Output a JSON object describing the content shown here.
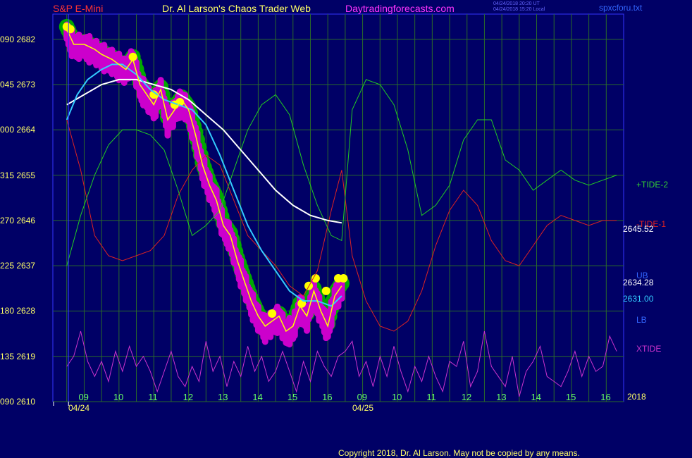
{
  "header": {
    "symbol": "S&P E-Mini",
    "author": "Dr. Al Larson's Chaos Trader Web",
    "site": "Daytradingforecasts.com",
    "stamp_ut": "04/24/2018 20:20 UT",
    "stamp_local": "04/24/2018 15:20 Local",
    "file": "spxcforu.txt"
  },
  "copyright": "Copyright 2018, Dr. Al Larson. May not be copied by any means.",
  "colors": {
    "background": "#000066",
    "plot_border": "#3333ff",
    "grid": "#2a6a2a",
    "price": "#ffff00",
    "bands": "#00aa00",
    "bars": "#cc00cc",
    "dots": "#ffff00",
    "fast_ma": "#33ccff",
    "slow_ma": "#ffffff",
    "tide2": "#22cc22",
    "tide1": "#dd2222",
    "xtide": "#cc33cc"
  },
  "chart_data": {
    "type": "line",
    "title": "S&P E-Mini",
    "ylim": [
      2610,
      2687
    ],
    "y_ticks": [
      {
        "prefix": "090",
        "value": "2682"
      },
      {
        "prefix": "045",
        "value": "2673"
      },
      {
        "prefix": "000",
        "value": "2664"
      },
      {
        "prefix": "315",
        "value": "2655"
      },
      {
        "prefix": "270",
        "value": "2646"
      },
      {
        "prefix": "225",
        "value": "2637"
      },
      {
        "prefix": "180",
        "value": "2628"
      },
      {
        "prefix": "135",
        "value": "2619"
      },
      {
        "prefix": "090",
        "value": "2610"
      }
    ],
    "x_ticks": [
      "09",
      "10",
      "11",
      "12",
      "13",
      "14",
      "15",
      "16",
      "09",
      "10",
      "11",
      "12",
      "13",
      "14",
      "15",
      "16"
    ],
    "date_labels": [
      "04/24",
      "04/25"
    ],
    "year_label": "2018",
    "session_break_x": 8.05,
    "series_labels": {
      "tide2": "+TIDE-2",
      "tide1": "-TIDE-1",
      "ub": "UB",
      "lb": "LB",
      "xtide": "XTIDE"
    },
    "last_values": {
      "slow_ma": "2645.52",
      "ub": "2634.28",
      "fast_ma": "2631.00"
    },
    "price": {
      "x": [
        8.0,
        8.2,
        8.5,
        8.8,
        9.0,
        9.3,
        9.5,
        9.7,
        9.9,
        10.1,
        10.3,
        10.5,
        10.7,
        10.9,
        11.1,
        11.3,
        11.5,
        11.7,
        11.9,
        12.1,
        12.3,
        12.5,
        12.7,
        12.9,
        13.1,
        13.3,
        13.5,
        13.7,
        13.9,
        14.1,
        14.3,
        14.5,
        14.7,
        14.9,
        15.1,
        15.3,
        15.5,
        15.7,
        15.9
      ],
      "y": [
        2684,
        2681,
        2681,
        2680,
        2679,
        2678,
        2677,
        2676,
        2678,
        2673,
        2671,
        2669,
        2672,
        2666,
        2668,
        2670,
        2668,
        2663,
        2657,
        2653,
        2650,
        2645,
        2643,
        2638,
        2634,
        2630,
        2627,
        2625,
        2626,
        2627,
        2624,
        2625,
        2629,
        2627,
        2632,
        2628,
        2625,
        2631,
        2633
      ]
    },
    "fast_ma": {
      "x": [
        8.0,
        8.3,
        8.6,
        9.0,
        9.3,
        9.6,
        10.0,
        10.4,
        10.8,
        11.2,
        11.6,
        12.0,
        12.4,
        12.8,
        13.2,
        13.6,
        14.0,
        14.4,
        14.8,
        15.2,
        15.6,
        15.9
      ],
      "y": [
        2666,
        2671,
        2674,
        2676,
        2677,
        2677,
        2675,
        2672,
        2670,
        2669,
        2668,
        2665,
        2659,
        2652,
        2645,
        2640,
        2636,
        2632,
        2630,
        2630,
        2629,
        2631
      ]
    },
    "slow_ma": {
      "x": [
        8.0,
        8.5,
        9.0,
        9.5,
        10.0,
        10.5,
        11.0,
        11.5,
        12.0,
        12.5,
        13.0,
        13.5,
        14.0,
        14.5,
        15.0,
        15.5,
        15.9
      ],
      "y": [
        2669,
        2671,
        2673,
        2674,
        2674,
        2673,
        2672,
        2670,
        2667,
        2664,
        2660,
        2656,
        2652,
        2649,
        2647,
        2646,
        2645.52
      ]
    },
    "tide2": {
      "x": [
        8.0,
        8.4,
        8.8,
        9.2,
        9.6,
        10.0,
        10.4,
        10.8,
        11.2,
        11.6,
        12.0,
        12.4,
        12.8,
        13.2,
        13.6,
        14.0,
        14.4,
        14.8,
        15.2,
        15.6,
        15.9,
        16.2,
        16.6,
        17.0,
        17.4,
        17.8,
        18.2,
        18.6,
        19.0,
        19.4,
        19.8,
        20.2,
        20.6,
        21.0,
        21.4,
        21.8,
        22.2,
        22.6,
        23.0,
        23.4,
        23.8
      ],
      "y": [
        2637,
        2647,
        2655,
        2661,
        2664,
        2664,
        2663,
        2660,
        2652,
        2643,
        2645,
        2648,
        2656,
        2664,
        2669,
        2671,
        2667,
        2657,
        2649,
        2643,
        2642,
        2668,
        2674,
        2673,
        2669,
        2660,
        2647,
        2649,
        2653,
        2662,
        2666,
        2666,
        2658,
        2656,
        2652,
        2654,
        2656,
        2654,
        2653,
        2654,
        2655
      ]
    },
    "tide1": {
      "x": [
        8.0,
        8.4,
        8.8,
        9.2,
        9.6,
        10.0,
        10.4,
        10.8,
        11.2,
        11.6,
        12.0,
        12.4,
        12.8,
        13.2,
        13.6,
        14.0,
        14.4,
        14.8,
        15.2,
        15.6,
        15.9,
        16.2,
        16.6,
        17.0,
        17.4,
        17.8,
        18.2,
        18.6,
        19.0,
        19.4,
        19.8,
        20.2,
        20.6,
        21.0,
        21.4,
        21.8,
        22.2,
        22.6,
        23.0,
        23.4,
        23.8
      ],
      "y": [
        2666,
        2656,
        2643,
        2639,
        2638,
        2639,
        2640,
        2643,
        2651,
        2656,
        2659,
        2657,
        2650,
        2643,
        2640,
        2637,
        2633,
        2631,
        2636,
        2648,
        2656,
        2639,
        2630,
        2625,
        2624,
        2626,
        2632,
        2641,
        2648,
        2652,
        2649,
        2642,
        2638,
        2637,
        2641,
        2645,
        2647,
        2646,
        2645,
        2646,
        2646
      ]
    },
    "xtide": {
      "x": [
        8.0,
        8.2,
        8.4,
        8.6,
        8.8,
        9.0,
        9.2,
        9.4,
        9.6,
        9.8,
        10.0,
        10.2,
        10.4,
        10.6,
        10.8,
        11.0,
        11.2,
        11.4,
        11.6,
        11.8,
        12.0,
        12.2,
        12.4,
        12.6,
        12.8,
        13.0,
        13.2,
        13.4,
        13.6,
        13.8,
        14.0,
        14.2,
        14.4,
        14.6,
        14.8,
        15.0,
        15.2,
        15.4,
        15.6,
        15.8,
        16.0,
        16.2,
        16.4,
        16.6,
        16.8,
        17.0,
        17.2,
        17.4,
        17.6,
        17.8,
        18.0,
        18.2,
        18.4,
        18.6,
        18.8,
        19.0,
        19.2,
        19.4,
        19.6,
        19.8,
        20.0,
        20.2,
        20.4,
        20.6,
        20.8,
        21.0,
        21.2,
        21.4,
        21.6,
        21.8,
        22.0,
        22.2,
        22.4,
        22.6,
        22.8,
        23.0,
        23.2,
        23.4,
        23.6,
        23.8
      ],
      "y": [
        2617,
        2619,
        2624,
        2618,
        2615,
        2618,
        2614,
        2620,
        2616,
        2621,
        2617,
        2619,
        2616,
        2612,
        2616,
        2620,
        2615,
        2613,
        2617,
        2614,
        2622,
        2616,
        2619,
        2613,
        2618,
        2615,
        2621,
        2616,
        2619,
        2614,
        2616,
        2620,
        2616,
        2612,
        2618,
        2614,
        2620,
        2617,
        2615,
        2619,
        2620,
        2622,
        2615,
        2618,
        2613,
        2619,
        2615,
        2621,
        2616,
        2612,
        2617,
        2614,
        2619,
        2615,
        2612,
        2618,
        2617,
        2622,
        2613,
        2616,
        2624,
        2617,
        2615,
        2613,
        2619,
        2611,
        2616,
        2618,
        2621,
        2615,
        2614,
        2613,
        2616,
        2620,
        2615,
        2619,
        2616,
        2617,
        2623,
        2620
      ]
    }
  }
}
